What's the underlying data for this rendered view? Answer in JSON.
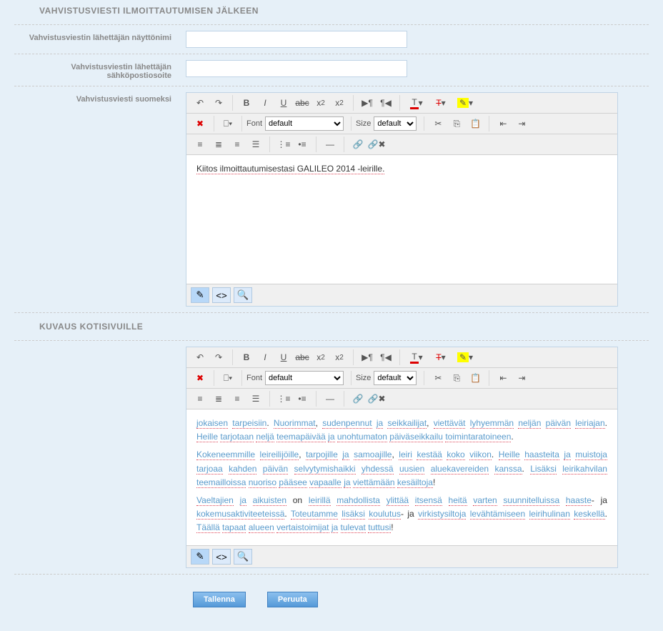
{
  "sections": {
    "confirm_header": "VAHVISTUSVIESTI ILMOITTAUTUMISEN JÄLKEEN",
    "desc_header": "KUVAUS KOTISIVUILLE"
  },
  "labels": {
    "sender_name": "Vahvistusviestin lähettäjän näyttönimi",
    "sender_email": "Vahvistusviestin lähettäjän sähköpostiosoite",
    "confirm_fi": "Vahvistusviesti suomeksi"
  },
  "fields": {
    "sender_name": "",
    "sender_email": ""
  },
  "editor": {
    "font_label": "Font",
    "size_label": "Size",
    "font_value": "default",
    "size_value": "default"
  },
  "confirm_content": "Kiitos ilmoittautumisestasi GALILEO 2014 -leirille.",
  "desc_content": {
    "p1a": "jokaisen",
    "p1b": "tarpeisiin",
    "p1c": "Nuorimmat",
    "p1d": "sudenpennut",
    "p1e": "ja",
    "p1f": "seikkailijat",
    "p1g": "viettävät",
    "p1h": "lyhyemmän",
    "p1i": "neljän",
    "p2a": "päivän",
    "p2b": "leiriajan",
    "p2c": "Heille",
    "p2d": "tarjotaan",
    "p2e": "neljä",
    "p2f": "teemapäivää",
    "p2g": "ja",
    "p2h": "unohtumaton",
    "p2i": "päiväseikkailu",
    "p3": "toimintaratoineen",
    "p4a": "Kokeneemmille",
    "p4b": "leireilijöille",
    "p4c": "tarpojille",
    "p4d": "ja",
    "p4e": "samoajille",
    "p4f": "leiri",
    "p4g": "kestää",
    "p4h": "koko",
    "p4i": "viikon",
    "p4j": "Heille",
    "p5a": "haasteita",
    "p5b": "ja",
    "p5c": "muistoja",
    "p5d": "tarjoaa",
    "p5e": "kahden",
    "p5f": "päivän",
    "p5g": "selvytymishaikki",
    "p5h": "yhdessä",
    "p5i": "uusien",
    "p6a": "aluekavereiden",
    "p6b": "kanssa",
    "p6c": "Lisäksi",
    "p6d": "leirikahvilan",
    "p6e": "teemailloissa",
    "p6f": "nuoriso",
    "p6g": "pääsee",
    "p6h": "vapaalle",
    "p6i": "ja",
    "p7a": "viettämään",
    "p7b": "kesäiltoja",
    "p8a": "Vaeltajien",
    "p8b": "ja",
    "p8c": "aikuisten",
    "p8d": " on ",
    "p8e": "leirillä",
    "p8f": "mahdollista",
    "p8g": "ylittää",
    "p8h": "itsensä",
    "p8i": "heitä",
    "p8j": "varten",
    "p8k": "suunnitelluissa",
    "p9a": "haaste",
    "p9b": "- ja ",
    "p9c": "kokemusaktiviteeteissä",
    "p9d": "Toteutamme",
    "p9e": "lisäksi",
    "p9f": "koulutus",
    "p9g": "- ja ",
    "p9h": "virkistysiltoja",
    "p10a": "levähtämiseen",
    "p10b": "leirihulinan",
    "p10c": "keskellä",
    "p10d": "Täällä",
    "p10e": "tapaat",
    "p10f": "alueen",
    "p10g": "vertaistoimijat",
    "p10h": "ja",
    "p10i": "tulevat",
    "p11": "tuttusi"
  },
  "buttons": {
    "save": "Tallenna",
    "cancel": "Peruuta"
  }
}
